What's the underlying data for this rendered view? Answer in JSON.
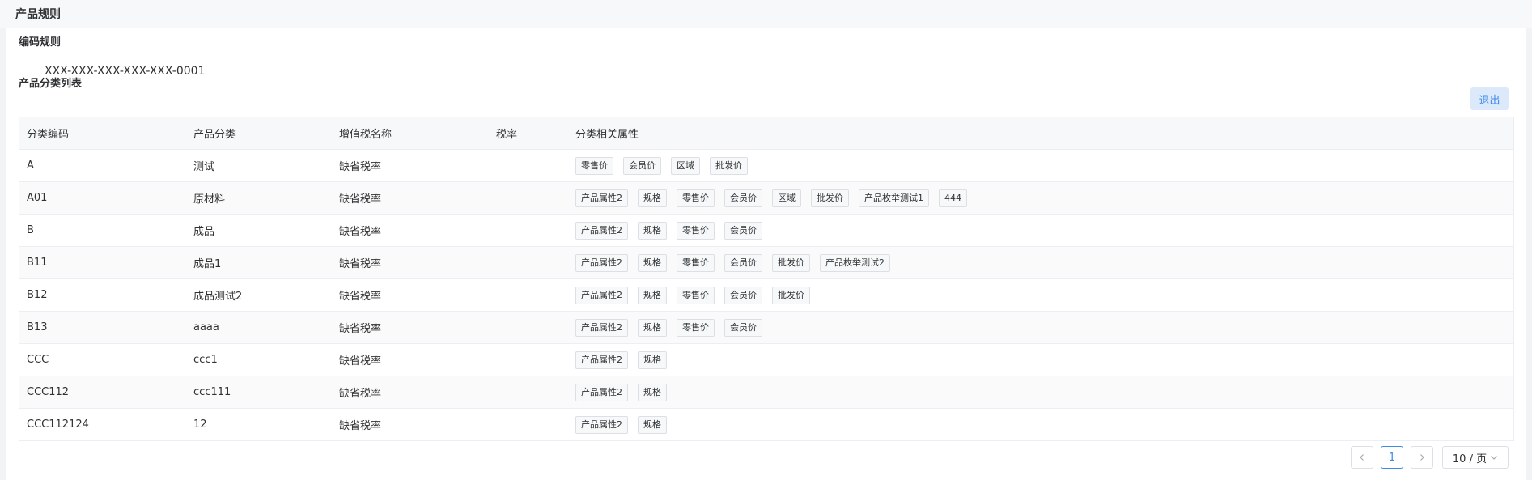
{
  "page_title": "产品规则",
  "code_rule": {
    "title": "编码规则",
    "value": "XXX-XXX-XXX-XXX-XXX-0001"
  },
  "category_list": {
    "title": "产品分类列表",
    "exit_label": "退出"
  },
  "table": {
    "headers": [
      "分类编码",
      "产品分类",
      "增值税名称",
      "税率",
      "分类相关属性"
    ],
    "rows": [
      {
        "code": "A",
        "category": "测试",
        "tax_name": "缺省税率",
        "rate": "",
        "tags": [
          "零售价",
          "会员价",
          "区域",
          "批发价"
        ]
      },
      {
        "code": "A01",
        "category": "原材料",
        "tax_name": "缺省税率",
        "rate": "",
        "tags": [
          "产品属性2",
          "规格",
          "零售价",
          "会员价",
          "区域",
          "批发价",
          "产品枚举测试1",
          "444"
        ]
      },
      {
        "code": "B",
        "category": "成品",
        "tax_name": "缺省税率",
        "rate": "",
        "tags": [
          "产品属性2",
          "规格",
          "零售价",
          "会员价"
        ]
      },
      {
        "code": "B11",
        "category": "成品1",
        "tax_name": "缺省税率",
        "rate": "",
        "tags": [
          "产品属性2",
          "规格",
          "零售价",
          "会员价",
          "批发价",
          "产品枚举测试2"
        ]
      },
      {
        "code": "B12",
        "category": "成品测试2",
        "tax_name": "缺省税率",
        "rate": "",
        "tags": [
          "产品属性2",
          "规格",
          "零售价",
          "会员价",
          "批发价"
        ]
      },
      {
        "code": "B13",
        "category": "aaaa",
        "tax_name": "缺省税率",
        "rate": "",
        "tags": [
          "产品属性2",
          "规格",
          "零售价",
          "会员价"
        ]
      },
      {
        "code": "CCC",
        "category": "ccc1",
        "tax_name": "缺省税率",
        "rate": "",
        "tags": [
          "产品属性2",
          "规格"
        ]
      },
      {
        "code": "CCC112",
        "category": "ccc111",
        "tax_name": "缺省税率",
        "rate": "",
        "tags": [
          "产品属性2",
          "规格"
        ]
      },
      {
        "code": "CCC112124",
        "category": "12",
        "tax_name": "缺省税率",
        "rate": "",
        "tags": [
          "产品属性2",
          "规格"
        ]
      }
    ]
  },
  "pagination": {
    "prev_icon": "chevron-left-icon",
    "current_page": "1",
    "next_icon": "chevron-right-icon",
    "page_size": "10 / 页"
  },
  "colors": {
    "accent": "#3f8ae6",
    "exit_bg": "#dbe9fb",
    "border": "#ebeef5"
  }
}
